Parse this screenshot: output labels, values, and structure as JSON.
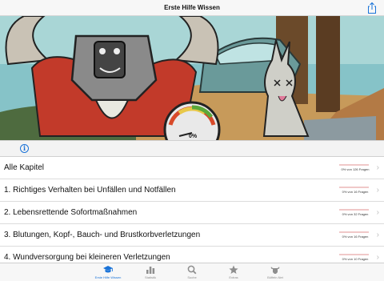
{
  "navbar": {
    "title": "Erste Hilfe Wissen",
    "share_icon": "share-icon"
  },
  "hero": {
    "gauge_value": "0%"
  },
  "info": {
    "icon": "info-icon"
  },
  "chapters": [
    {
      "label": "Alle Kapitel",
      "progress_text": "0% von 126 Fragen",
      "progress": 0
    },
    {
      "label": "1. Richtiges Verhalten bei Unfällen und Notfällen",
      "progress_text": "0% von 16 Fragen",
      "progress": 0
    },
    {
      "label": "2. Lebensrettende Sofortmaßnahmen",
      "progress_text": "0% von 32 Fragen",
      "progress": 0
    },
    {
      "label": "3. Blutungen, Kopf-, Bauch- und Brustkorbverletzungen",
      "progress_text": "0% von 16 Fragen",
      "progress": 0
    },
    {
      "label": "4. Wundversorgung bei kleineren Verletzungen",
      "progress_text": "0% von 10 Fragen",
      "progress": 0
    }
  ],
  "tabs": [
    {
      "label": "Erste Hilfe Wissen",
      "icon": "graduation-cap-icon",
      "active": true
    },
    {
      "label": "Statistik",
      "icon": "bar-chart-icon",
      "active": false
    },
    {
      "label": "Suche",
      "icon": "search-icon",
      "active": false
    },
    {
      "label": "Extras",
      "icon": "star-icon",
      "active": false
    },
    {
      "label": "Büffeln.Net",
      "icon": "buffalo-icon",
      "active": false
    }
  ],
  "colors": {
    "accent": "#1a73d8",
    "progress": "#e02020",
    "inactive_tab": "#8e8e8e"
  }
}
